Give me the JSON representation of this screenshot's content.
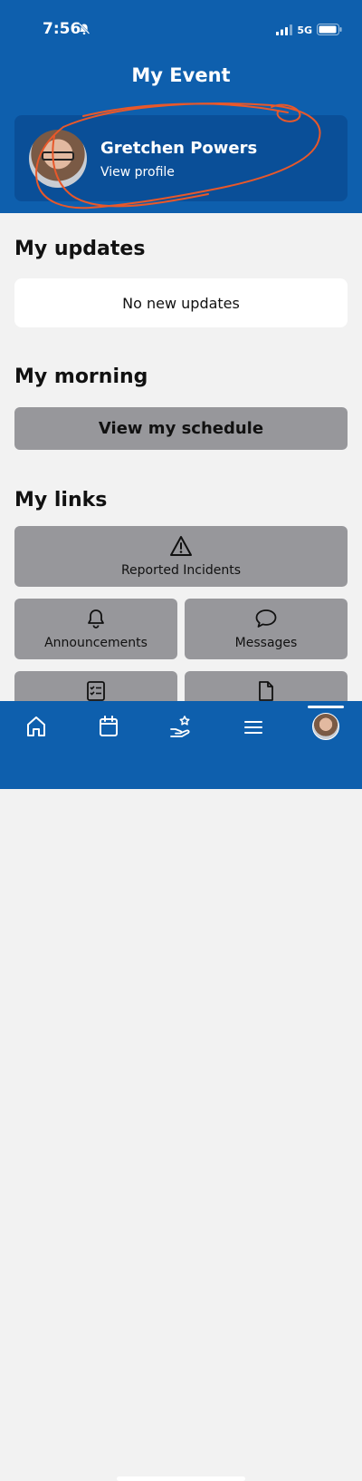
{
  "status_bar": {
    "time": "7:56",
    "network": "5G"
  },
  "header": {
    "title": "My Event"
  },
  "profile": {
    "name": "Gretchen Powers",
    "link_label": "View profile"
  },
  "sections": {
    "updates": "My updates",
    "morning": "My morning",
    "links": "My links"
  },
  "updates": {
    "empty_message": "No new updates"
  },
  "morning": {
    "schedule_button": "View my schedule"
  },
  "links": [
    {
      "label": "Reported Incidents",
      "icon": "warning-icon"
    },
    {
      "label": "Announcements",
      "icon": "bell-icon"
    },
    {
      "label": "Messages",
      "icon": "chat-bubble-icon"
    },
    {
      "label": "",
      "icon": "checklist-icon"
    },
    {
      "label": "",
      "icon": "document-icon"
    }
  ],
  "bottom_nav": {
    "items": [
      "home-icon",
      "calendar-icon",
      "hand-star-icon",
      "menu-icon",
      "profile-avatar"
    ]
  },
  "colors": {
    "primary": "#0e5fad",
    "card": "#0a4f98",
    "tile": "#97979b",
    "background": "#f2f2f2",
    "scribble": "#e8582a"
  }
}
